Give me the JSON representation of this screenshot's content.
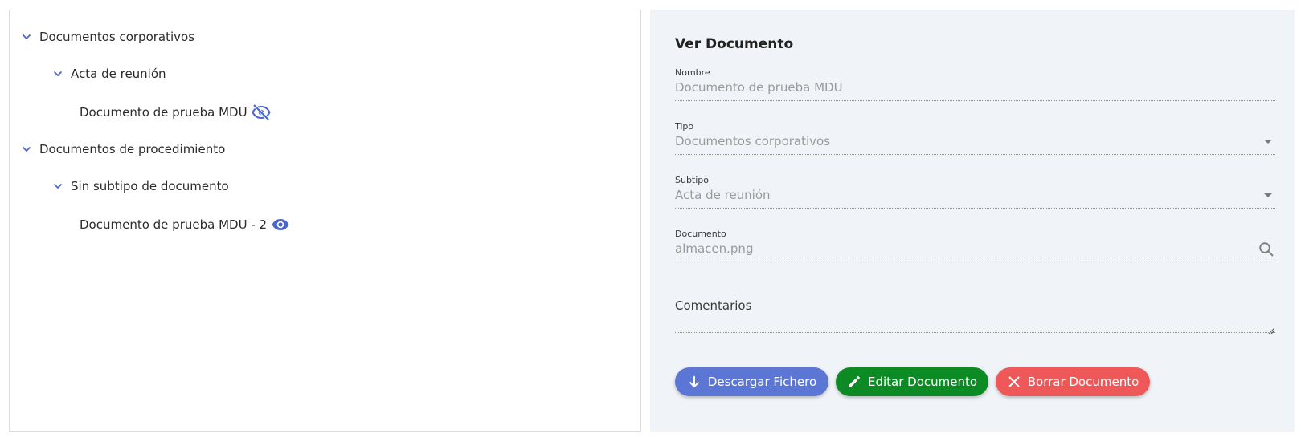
{
  "tree": {
    "categories": [
      {
        "label": "Documentos corporativos",
        "subtypes": [
          {
            "label": "Acta de reunión",
            "documents": [
              {
                "label": "Documento de prueba MDU",
                "visibility_icon": "eye-off-icon"
              }
            ]
          }
        ]
      },
      {
        "label": "Documentos de procedimiento",
        "subtypes": [
          {
            "label": "Sin subtipo de documento",
            "documents": [
              {
                "label": "Documento de prueba MDU - 2",
                "visibility_icon": "eye-icon"
              }
            ]
          }
        ]
      }
    ]
  },
  "detail": {
    "title": "Ver Documento",
    "nombre": {
      "label": "Nombre",
      "value": "Documento de prueba MDU"
    },
    "tipo": {
      "label": "Tipo",
      "value": "Documentos corporativos"
    },
    "subtipo": {
      "label": "Subtipo",
      "value": "Acta de reunión"
    },
    "documento": {
      "label": "Documento",
      "value": "almacen.png"
    },
    "comentarios": {
      "label": "Comentarios",
      "value": ""
    }
  },
  "actions": {
    "download_label": "Descargar Fichero",
    "edit_label": "Editar Documento",
    "delete_label": "Borrar Documento"
  },
  "colors": {
    "accent_icon": "#4a67c9",
    "download_button": "#5b76d4",
    "edit_button": "#0c8a23",
    "delete_button": "#ee5858",
    "detail_background": "#f0f3f7"
  }
}
